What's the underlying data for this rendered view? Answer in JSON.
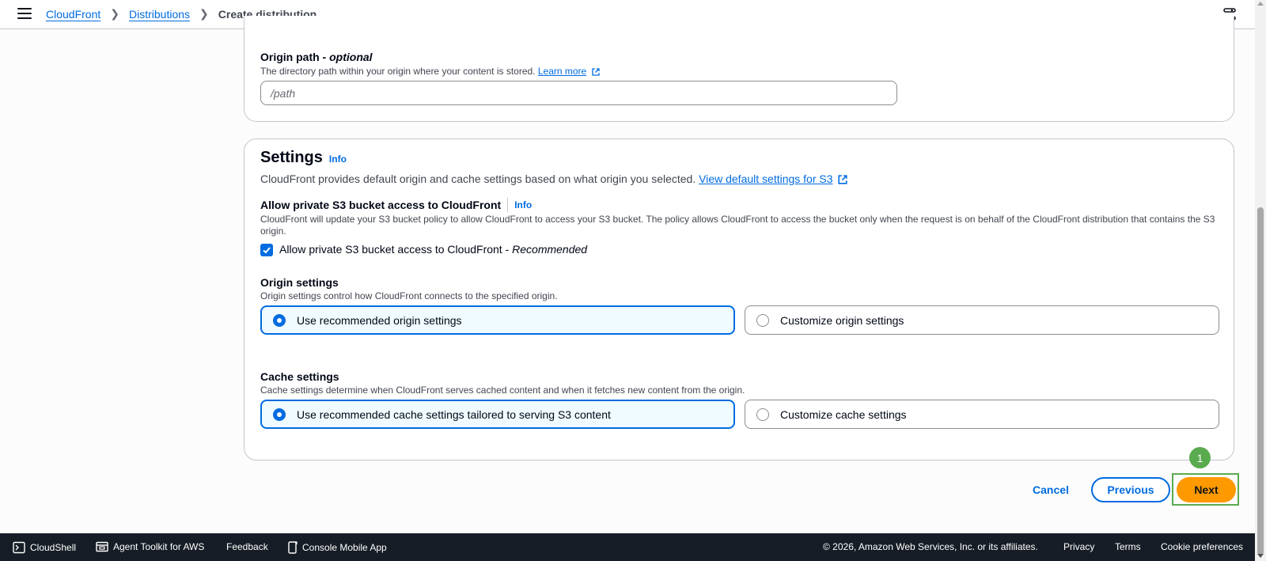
{
  "breadcrumb": {
    "items": [
      "CloudFront",
      "Distributions"
    ],
    "current": "Create distribution"
  },
  "origin_path": {
    "label": "Origin path - ",
    "label_optional": "optional",
    "description": "The directory path within your origin where your content is stored.",
    "learn_more": "Learn more",
    "placeholder": "/path"
  },
  "settings": {
    "title": "Settings",
    "info": "Info",
    "description": "CloudFront provides default origin and cache settings based on what origin you selected.",
    "view_defaults_link": "View default settings for S3",
    "private_access": {
      "label": "Allow private S3 bucket access to CloudFront",
      "info": "Info",
      "description": "CloudFront will update your S3 bucket policy to allow CloudFront to access your S3 bucket. The policy allows CloudFront to access the bucket only when the request is on behalf of the CloudFront distribution that contains the S3 origin.",
      "checkbox_label": "Allow private S3 bucket access to CloudFront - ",
      "checkbox_label_em": "Recommended",
      "checked": true
    },
    "origin_settings": {
      "label": "Origin settings",
      "description": "Origin settings control how CloudFront connects to the specified origin.",
      "option_recommended": "Use recommended origin settings",
      "option_custom": "Customize origin settings",
      "selected": "recommended"
    },
    "cache_settings": {
      "label": "Cache settings",
      "description": "Cache settings determine when CloudFront serves cached content and when it fetches new content from the origin.",
      "option_recommended": "Use recommended cache settings tailored to serving S3 content",
      "option_custom": "Customize cache settings",
      "selected": "recommended"
    }
  },
  "actions": {
    "cancel": "Cancel",
    "previous": "Previous",
    "next": "Next"
  },
  "annotation_marker": "1",
  "footer": {
    "cloudshell": "CloudShell",
    "agent_toolkit": "Agent Toolkit for AWS",
    "feedback": "Feedback",
    "mobile_app": "Console Mobile App",
    "copyright": "© 2026, Amazon Web Services, Inc. or its affiliates.",
    "privacy": "Privacy",
    "terms": "Terms",
    "cookies": "Cookie preferences"
  },
  "colors": {
    "accent": "#006ce0",
    "primary_button": "#ff9900",
    "footer_bg": "#161d26",
    "marker": "#5aab4f"
  }
}
